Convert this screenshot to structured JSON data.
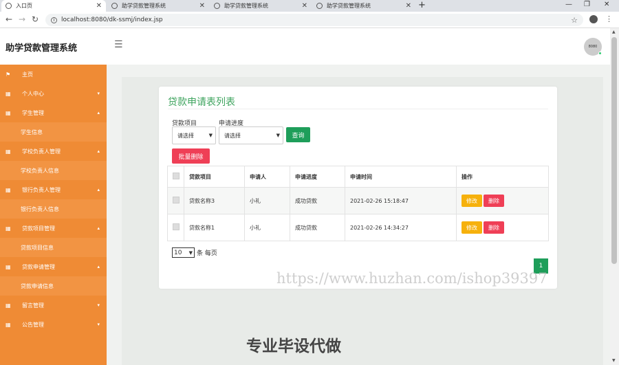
{
  "browser": {
    "tabs": [
      {
        "label": "入口页",
        "active": true
      },
      {
        "label": "助学贷款管理系统",
        "active": false
      },
      {
        "label": "助学贷款管理系统",
        "active": false
      },
      {
        "label": "助学贷款管理系统",
        "active": false
      }
    ],
    "url": "localhost:8080/dk-ssmj/index.jsp"
  },
  "header": {
    "title": "助学贷款管理系统",
    "avatar_text": "8080"
  },
  "sidebar": {
    "items": [
      {
        "label": "主页",
        "icon": "flag-icon",
        "type": "top",
        "caret": ""
      },
      {
        "label": "个人中心",
        "icon": "grid-icon",
        "type": "top",
        "caret": "▾"
      },
      {
        "label": "学生管理",
        "icon": "grid-icon",
        "type": "top",
        "caret": "▴"
      },
      {
        "label": "学生信息",
        "icon": "",
        "type": "sub",
        "caret": ""
      },
      {
        "label": "学校负责人管理",
        "icon": "grid-icon",
        "type": "top",
        "caret": "▴"
      },
      {
        "label": "学校负责人信息",
        "icon": "",
        "type": "sub",
        "caret": ""
      },
      {
        "label": "银行负责人管理",
        "icon": "grid-icon",
        "type": "top",
        "caret": "▴"
      },
      {
        "label": "银行负责人信息",
        "icon": "",
        "type": "sub",
        "caret": ""
      },
      {
        "label": "贷款项目管理",
        "icon": "grid-icon",
        "type": "top",
        "caret": "▴"
      },
      {
        "label": "贷款项目信息",
        "icon": "",
        "type": "sub",
        "caret": ""
      },
      {
        "label": "贷款申请管理",
        "icon": "grid-icon",
        "type": "top",
        "caret": "▴"
      },
      {
        "label": "贷款申请信息",
        "icon": "",
        "type": "sub",
        "caret": ""
      },
      {
        "label": "留言管理",
        "icon": "grid-icon",
        "type": "top",
        "caret": "▾"
      },
      {
        "label": "公告管理",
        "icon": "grid-icon",
        "type": "top",
        "caret": "▾"
      }
    ]
  },
  "main": {
    "title": "贷款申请表列表",
    "filters": {
      "project_label": "贷款项目",
      "project_value": "请选择",
      "progress_label": "申请进度",
      "progress_value": "请选择",
      "search_button": "查询"
    },
    "batch_delete": "批量删除",
    "table": {
      "columns": [
        "贷款项目",
        "申请人",
        "申请进度",
        "申请时间",
        "操作"
      ],
      "rows": [
        {
          "project": "贷款名称3",
          "applicant": "小礼",
          "progress": "成功贷款",
          "time": "2021-02-26 15:18:47"
        },
        {
          "project": "贷款名称1",
          "applicant": "小礼",
          "progress": "成功贷款",
          "time": "2021-02-26 14:34:27"
        }
      ],
      "edit_label": "修改",
      "delete_label": "删除"
    },
    "pagination": {
      "page_size": "10",
      "per_page_text": "条 每页",
      "current_page": "1"
    }
  },
  "overlay": {
    "watermark": "https://www.huzhan.com/ishop39397",
    "promo": "专业毕设代做"
  },
  "colors": {
    "sidebar": "#ef8b35",
    "accent_green": "#1e9e5a",
    "danger": "#ef3f56",
    "warning": "#f6b10c"
  }
}
